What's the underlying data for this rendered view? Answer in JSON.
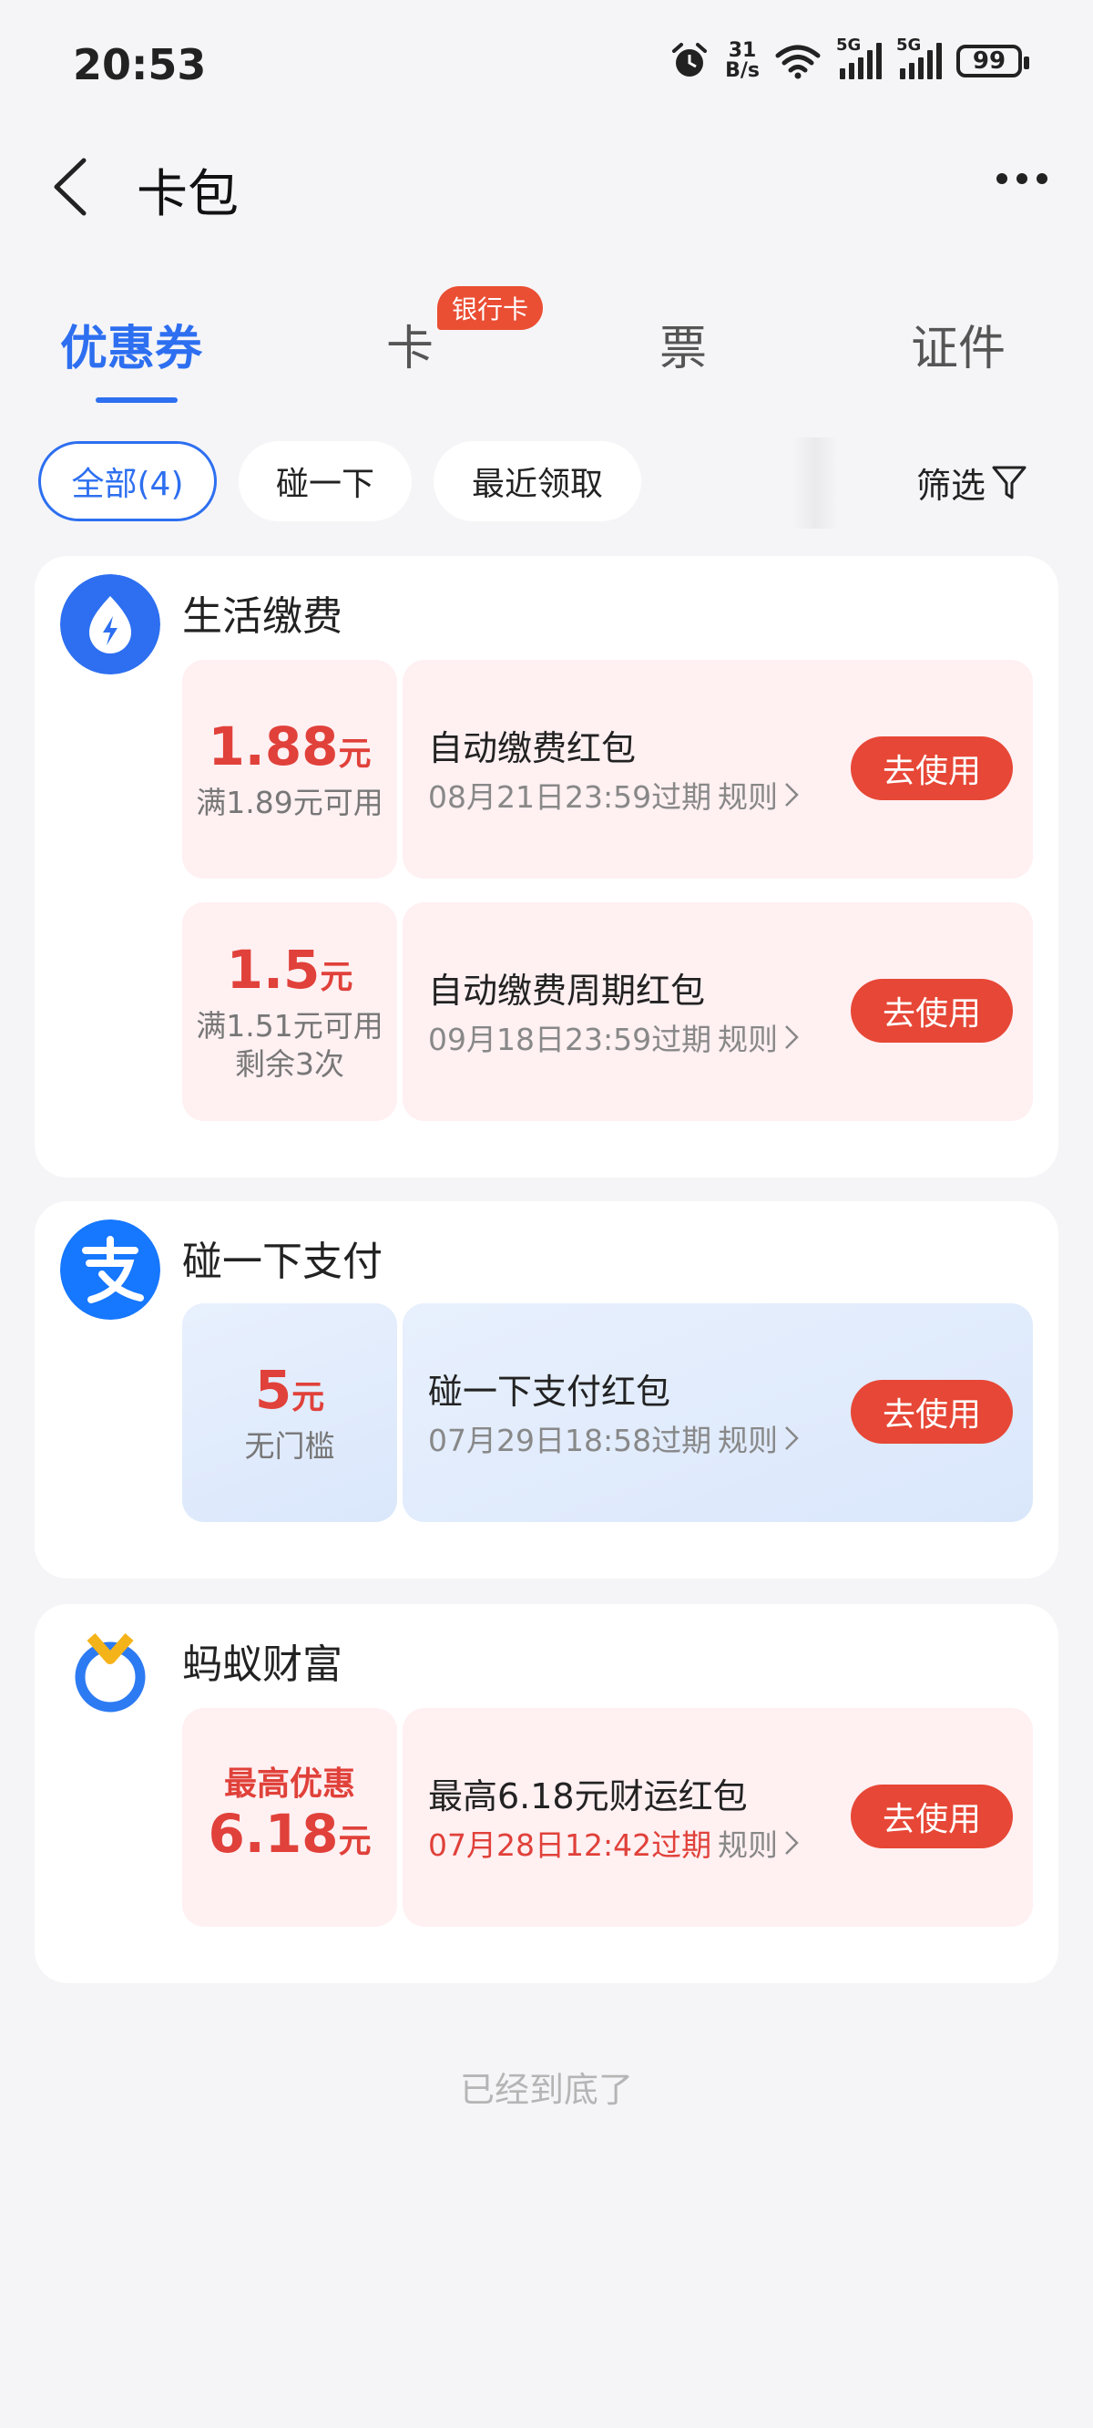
{
  "status_bar": {
    "time": "20:53",
    "net_speed_value": "31",
    "net_speed_unit": "B/s",
    "signal1_label": "5G",
    "signal2_label": "5G",
    "battery": "99"
  },
  "header": {
    "title": "卡包"
  },
  "tabs": [
    {
      "label": "优惠券",
      "active": true
    },
    {
      "label": "卡",
      "badge": "银行卡"
    },
    {
      "label": "票"
    },
    {
      "label": "证件"
    }
  ],
  "filters": {
    "chips": [
      "全部(4)",
      "碰一下",
      "最近领取"
    ],
    "filter_label": "筛选"
  },
  "cards": [
    {
      "title": "生活缴费",
      "icon": "lightning-icon",
      "coupons": [
        {
          "amount": "1.88",
          "unit": "元",
          "cond1": "满1.89元可用",
          "name": "自动缴费红包",
          "expire": "08月21日23:59过期",
          "rule": "规则",
          "action": "去使用"
        },
        {
          "amount": "1.5",
          "unit": "元",
          "cond1": "满1.51元可用",
          "cond2": "剩余3次",
          "name": "自动缴费周期红包",
          "expire": "09月18日23:59过期",
          "rule": "规则",
          "action": "去使用"
        }
      ]
    },
    {
      "title": "碰一下支付",
      "icon": "alipay-icon",
      "coupons": [
        {
          "amount": "5",
          "unit": "元",
          "cond1": "无门槛",
          "name": "碰一下支付红包",
          "expire": "07月29日18:58过期",
          "rule": "规则",
          "action": "去使用"
        }
      ]
    },
    {
      "title": "蚂蚁财富",
      "icon": "ant-fortune-icon",
      "coupons": [
        {
          "top": "最高优惠",
          "amount": "6.18",
          "unit": "元",
          "name": "最高6.18元财运红包",
          "expire": "07月28日12:42过期",
          "rule": "规则",
          "action": "去使用"
        }
      ]
    }
  ],
  "footer": {
    "end_text": "已经到底了"
  },
  "colors": {
    "accent": "#2d6ff0",
    "red": "#e0413a",
    "button_red": "#e74736"
  }
}
